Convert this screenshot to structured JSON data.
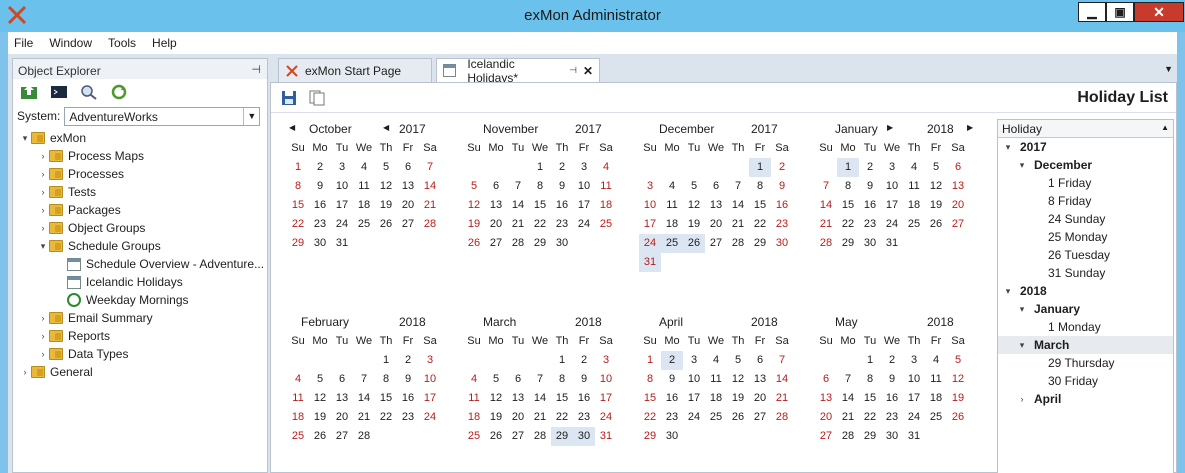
{
  "window": {
    "title": "exMon Administrator"
  },
  "menu": [
    "File",
    "Window",
    "Tools",
    "Help"
  ],
  "explorer": {
    "title": "Object Explorer",
    "system_label": "System:",
    "system_value": "AdventureWorks",
    "tree": [
      {
        "label": "exMon",
        "level": 0,
        "toggle": "▾",
        "icon": "folder"
      },
      {
        "label": "Process Maps",
        "level": 1,
        "toggle": "›",
        "icon": "folder"
      },
      {
        "label": "Processes",
        "level": 1,
        "toggle": "›",
        "icon": "folder"
      },
      {
        "label": "Tests",
        "level": 1,
        "toggle": "›",
        "icon": "folder"
      },
      {
        "label": "Packages",
        "level": 1,
        "toggle": "›",
        "icon": "folder"
      },
      {
        "label": "Object Groups",
        "level": 1,
        "toggle": "›",
        "icon": "folder"
      },
      {
        "label": "Schedule Groups",
        "level": 1,
        "toggle": "▾",
        "icon": "folder"
      },
      {
        "label": "Schedule Overview - Adventure...",
        "level": 2,
        "toggle": "",
        "icon": "schedule"
      },
      {
        "label": "Icelandic Holidays",
        "level": 2,
        "toggle": "",
        "icon": "schedule"
      },
      {
        "label": "Weekday Mornings",
        "level": 2,
        "toggle": "",
        "icon": "clock"
      },
      {
        "label": "Email Summary",
        "level": 1,
        "toggle": "›",
        "icon": "folder"
      },
      {
        "label": "Reports",
        "level": 1,
        "toggle": "›",
        "icon": "folder"
      },
      {
        "label": "Data Types",
        "level": 1,
        "toggle": "›",
        "icon": "folder"
      },
      {
        "label": "General",
        "level": 0,
        "toggle": "›",
        "icon": "folder"
      }
    ]
  },
  "tabs": [
    {
      "label": "exMon Start Page",
      "active": false
    },
    {
      "label": "Icelandic Holidays*",
      "active": true
    }
  ],
  "document": {
    "title": "Holiday List"
  },
  "calendar": {
    "weekdays": [
      "Su",
      "Mo",
      "Tu",
      "We",
      "Th",
      "Fr",
      "Sa"
    ],
    "months": [
      {
        "name": "October",
        "year": "2017",
        "offset": 0,
        "days": 31,
        "holidays": []
      },
      {
        "name": "November",
        "year": "2017",
        "offset": 3,
        "days": 30,
        "holidays": []
      },
      {
        "name": "December",
        "year": "2017",
        "offset": 5,
        "days": 31,
        "holidays": [
          1,
          24,
          25,
          26,
          31
        ]
      },
      {
        "name": "January",
        "year": "2018",
        "offset": 1,
        "days": 31,
        "holidays": [
          1
        ]
      },
      {
        "name": "February",
        "year": "2018",
        "offset": 4,
        "days": 28,
        "holidays": []
      },
      {
        "name": "March",
        "year": "2018",
        "offset": 4,
        "days": 31,
        "holidays": [
          29,
          30
        ]
      },
      {
        "name": "April",
        "year": "2018",
        "offset": 0,
        "days": 30,
        "holidays": [
          2
        ]
      },
      {
        "name": "May",
        "year": "2018",
        "offset": 2,
        "days": 31,
        "holidays": []
      }
    ]
  },
  "holiday_list": {
    "header": "Holiday",
    "rows": [
      {
        "label": "2017",
        "level": 0,
        "toggle": "▾",
        "bold": true
      },
      {
        "label": "December",
        "level": 1,
        "toggle": "▾",
        "bold": true
      },
      {
        "label": "1 Friday",
        "level": 2
      },
      {
        "label": "8 Friday",
        "level": 2
      },
      {
        "label": "24 Sunday",
        "level": 2
      },
      {
        "label": "25 Monday",
        "level": 2
      },
      {
        "label": "26 Tuesday",
        "level": 2
      },
      {
        "label": "31 Sunday",
        "level": 2
      },
      {
        "label": "2018",
        "level": 0,
        "toggle": "▾",
        "bold": true
      },
      {
        "label": "January",
        "level": 1,
        "toggle": "▾",
        "bold": true
      },
      {
        "label": "1 Monday",
        "level": 2
      },
      {
        "label": "March",
        "level": 1,
        "toggle": "▾",
        "bold": true,
        "selected": true
      },
      {
        "label": "29 Thursday",
        "level": 2
      },
      {
        "label": "30 Friday",
        "level": 2
      },
      {
        "label": "April",
        "level": 1,
        "toggle": "›",
        "bold": true
      }
    ]
  },
  "colors": {
    "titlebar": "#6ac1ec",
    "weekend": "#b81c1c",
    "holiday_highlight": "#dbe6f2"
  }
}
